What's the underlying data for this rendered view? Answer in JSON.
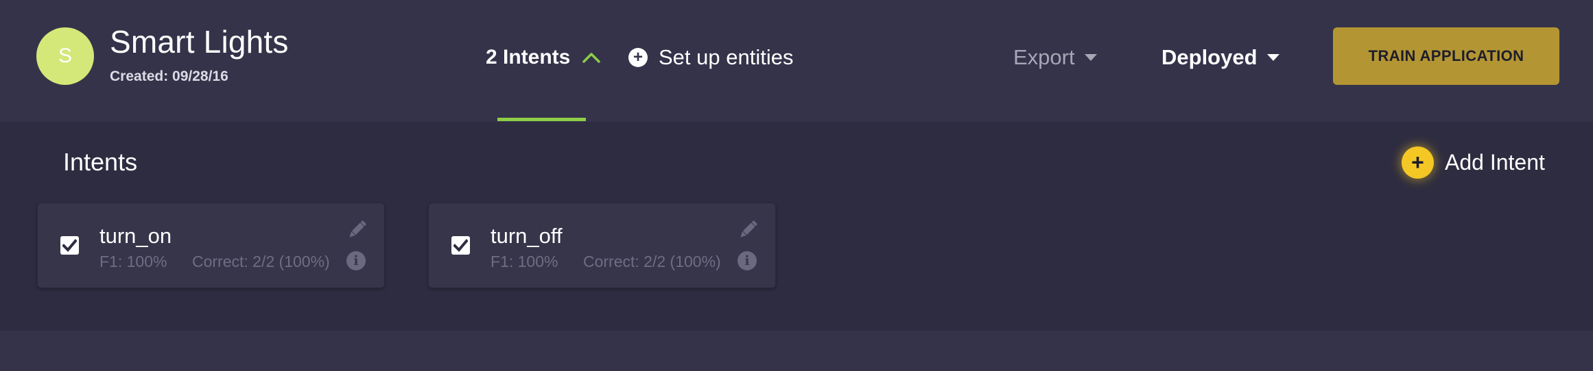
{
  "app": {
    "avatar_letter": "S",
    "title": "Smart Lights",
    "created_label": "Created:",
    "created_date": "09/28/16"
  },
  "nav": {
    "intents_tab": "2 Intents",
    "setup_entities": "Set up entities",
    "export": "Export",
    "deployed": "Deployed",
    "train_button": "TRAIN APPLICATION"
  },
  "section": {
    "title": "Intents",
    "add_intent": "Add Intent",
    "add_icon": "plus-circle-icon"
  },
  "intents": [
    {
      "name": "turn_on",
      "f1": "F1: 100%",
      "correct": "Correct: 2/2 (100%)",
      "checked": true
    },
    {
      "name": "turn_off",
      "f1": "F1: 100%",
      "correct": "Correct: 2/2 (100%)",
      "checked": true
    }
  ],
  "colors": {
    "header_bg": "#35334a",
    "content_bg": "#2e2c40",
    "card_bg": "#37354a",
    "avatar": "#d3e878",
    "accent_green": "#8ccf46",
    "train_button": "#b39633",
    "add_button": "#f4c724",
    "muted_text": "#6f6d82"
  }
}
